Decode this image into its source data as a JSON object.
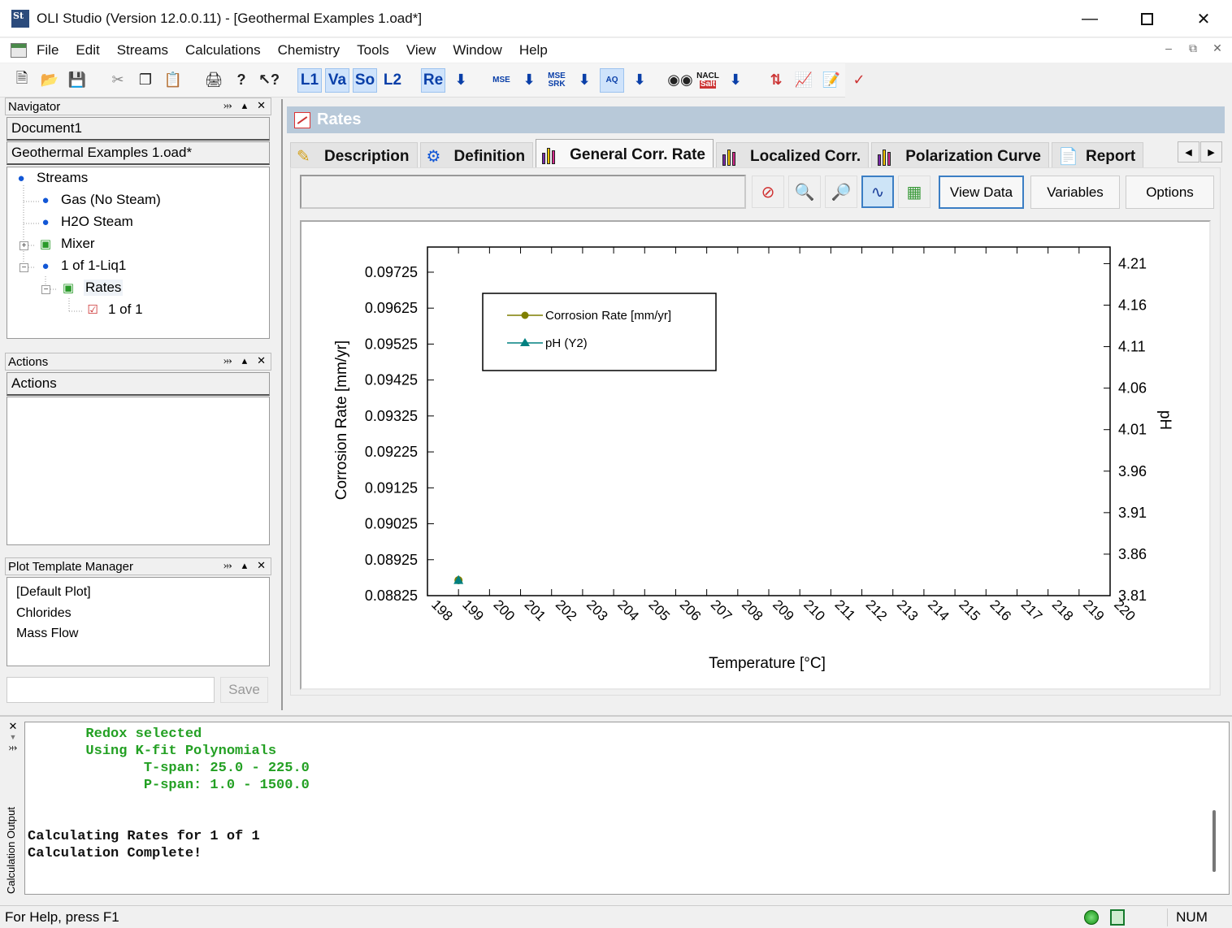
{
  "window": {
    "title": "OLI Studio (Version 12.0.0.11) - [Geothermal Examples 1.oad*]",
    "app_badge": "St"
  },
  "menu": [
    "File",
    "Edit",
    "Streams",
    "Calculations",
    "Chemistry",
    "Tools",
    "View",
    "Window",
    "Help"
  ],
  "toolbar": {
    "labels": {
      "l1": "L1",
      "va": "Va",
      "so": "So",
      "l2": "L2",
      "re": "Re",
      "mse": "MSE",
      "mse_srk_1": "MSE",
      "mse_srk_2": "SRK",
      "aq": "AQ",
      "nacl_1": "NACL",
      "nacl_2": "Salt"
    }
  },
  "navigator": {
    "title": "Navigator",
    "documents": [
      "Document1",
      "Geothermal Examples 1.oad*"
    ],
    "tree": [
      "Streams",
      "Gas (No Steam)",
      "H2O Steam",
      "Mixer",
      "1 of 1-Liq1",
      "Rates",
      "1 of 1"
    ]
  },
  "actions": {
    "title": "Actions",
    "tab": "Actions"
  },
  "plot_template_manager": {
    "title": "Plot Template Manager",
    "items": [
      "[Default Plot]",
      "Chlorides",
      "Mass Flow"
    ],
    "save_label": "Save",
    "input_value": ""
  },
  "document": {
    "header": "Rates",
    "tabs": [
      "Description",
      "Definition",
      "General Corr. Rate",
      "Localized Corr.",
      "Polarization Curve",
      "Report"
    ],
    "active_tab": "General Corr. Rate",
    "status_value": "",
    "buttons": {
      "view_data": "View Data",
      "variables": "Variables",
      "options": "Options"
    }
  },
  "chart_data": {
    "type": "scatter",
    "xlabel": "Temperature [°C]",
    "ylabel": "Corrosion Rate [mm/yr]",
    "y2label": "pH",
    "xlim": [
      198,
      220
    ],
    "xticks": [
      "198",
      "199",
      "200",
      "201",
      "202",
      "203",
      "204",
      "205",
      "206",
      "207",
      "208",
      "209",
      "210",
      "211",
      "212",
      "213",
      "214",
      "215",
      "216",
      "217",
      "218",
      "219",
      "220"
    ],
    "ylim": [
      0.08825,
      0.09795
    ],
    "yticks": [
      "0.09725",
      "0.09625",
      "0.09525",
      "0.09425",
      "0.09325",
      "0.09225",
      "0.09125",
      "0.09025",
      "0.08925",
      "0.08825"
    ],
    "y2lim": [
      3.81,
      4.23
    ],
    "y2ticks": [
      "4.21",
      "4.16",
      "4.11",
      "4.06",
      "4.01",
      "3.96",
      "3.91",
      "3.86",
      "3.81"
    ],
    "legend_position": "top-left",
    "series": [
      {
        "name": "Corrosion Rate [mm/yr]",
        "axis": "y",
        "marker": "circle",
        "color": "#7f7f00",
        "points": [
          {
            "x": 199,
            "y": 0.08868
          }
        ]
      },
      {
        "name": "pH (Y2)",
        "axis": "y2",
        "marker": "triangle",
        "color": "#008080",
        "points": [
          {
            "x": 199,
            "y": 3.829
          }
        ]
      }
    ]
  },
  "output": {
    "label": "Calculation Output",
    "lines": [
      {
        "text": "       Redox selected",
        "color": "green"
      },
      {
        "text": "       Using K-fit Polynomials",
        "color": "green"
      },
      {
        "text": "              T-span: 25.0 - 225.0",
        "color": "green"
      },
      {
        "text": "              P-span: 1.0 - 1500.0",
        "color": "green"
      },
      {
        "text": "",
        "color": "black"
      },
      {
        "text": "",
        "color": "black"
      },
      {
        "text": "Calculating Rates for 1 of 1",
        "color": "black"
      },
      {
        "text": "Calculation Complete!",
        "color": "black"
      }
    ]
  },
  "statusbar": {
    "help": "For Help, press F1",
    "num": "NUM"
  }
}
